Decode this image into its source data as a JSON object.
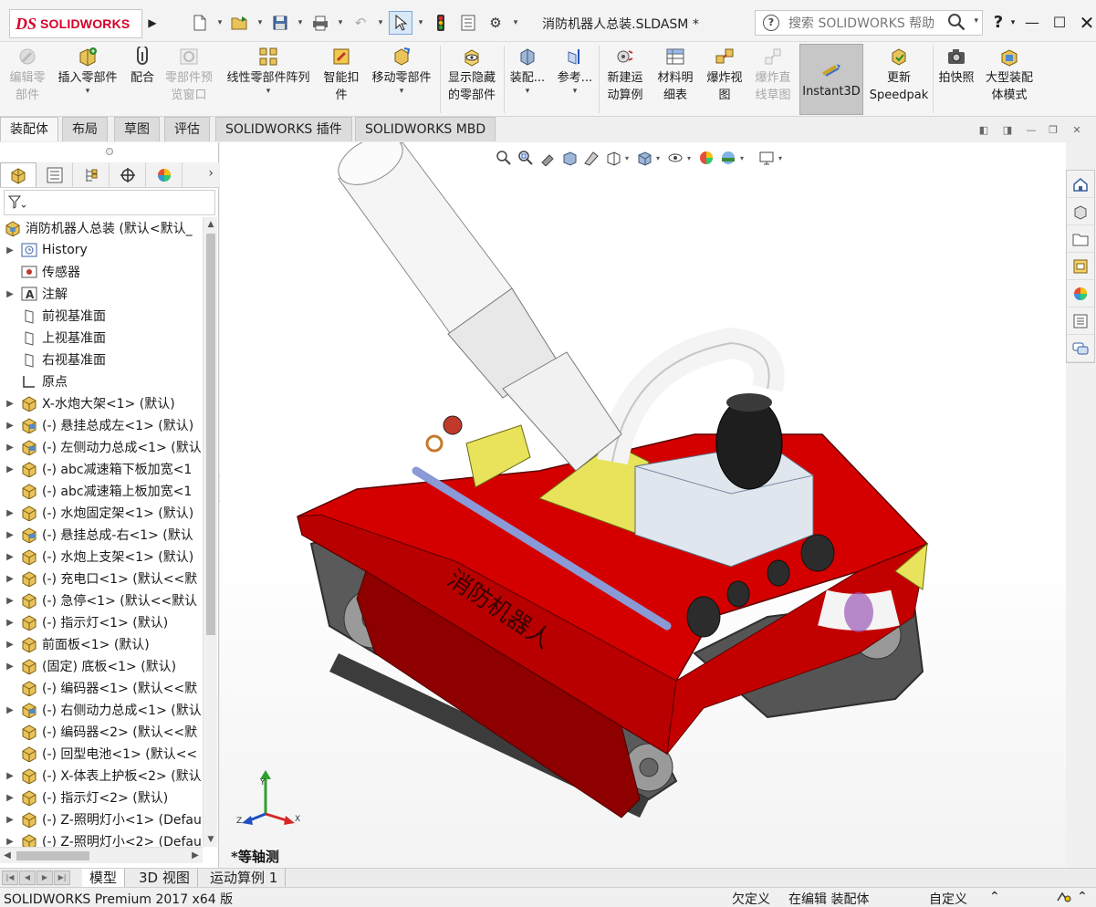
{
  "app": {
    "logo_ds": "DS",
    "logo_name": "SOLIDWORKS",
    "document_title": "消防机器人总装.SLDASM *",
    "search_placeholder": "搜索 SOLIDWORKS 帮助",
    "help_label": "?"
  },
  "ribbon": {
    "buttons": [
      {
        "label": "编辑零\n部件",
        "icon": "edit-component-icon",
        "disabled": true
      },
      {
        "label": "插入零部件",
        "icon": "insert-component-icon",
        "disabled": false
      },
      {
        "label": "配合",
        "icon": "mate-icon",
        "disabled": false
      },
      {
        "label": "零部件预\n览窗口",
        "icon": "preview-window-icon",
        "disabled": true
      },
      {
        "label": "线性零部件阵列",
        "icon": "linear-pattern-icon",
        "disabled": false
      },
      {
        "label": "智能扣\n件",
        "icon": "smart-fastener-icon",
        "disabled": false
      },
      {
        "label": "移动零部件",
        "icon": "move-component-icon",
        "disabled": false
      },
      {
        "label": "显示隐藏\n的零部件",
        "icon": "show-hidden-icon",
        "disabled": false
      },
      {
        "label": "装配...",
        "icon": "assembly-features-icon",
        "disabled": false
      },
      {
        "label": "参考...",
        "icon": "reference-geometry-icon",
        "disabled": false
      },
      {
        "label": "新建运\n动算例",
        "icon": "motion-study-icon",
        "disabled": false
      },
      {
        "label": "材料明\n细表",
        "icon": "bom-icon",
        "disabled": false
      },
      {
        "label": "爆炸视\n图",
        "icon": "exploded-view-icon",
        "disabled": false
      },
      {
        "label": "爆炸直\n线草图",
        "icon": "explode-line-icon",
        "disabled": true
      },
      {
        "label": "Instant3D",
        "icon": "instant3d-icon",
        "disabled": false
      },
      {
        "label": "更新\nSpeedpak",
        "icon": "speedpak-icon",
        "disabled": false
      },
      {
        "label": "拍快照",
        "icon": "snapshot-icon",
        "disabled": false
      },
      {
        "label": "大型装配\n体模式",
        "icon": "large-assembly-icon",
        "disabled": false
      }
    ]
  },
  "tabs": [
    "装配体",
    "布局",
    "草图",
    "评估",
    "SOLIDWORKS 插件",
    "SOLIDWORKS MBD"
  ],
  "tree": {
    "root": "消防机器人总装 (默认<默认_",
    "items": [
      {
        "label": "History",
        "icon": "history-icon",
        "expand": true
      },
      {
        "label": "传感器",
        "icon": "sensor-icon",
        "expand": false
      },
      {
        "label": "注解",
        "icon": "annotation-icon",
        "expand": true
      },
      {
        "label": "前视基准面",
        "icon": "plane-icon",
        "expand": false
      },
      {
        "label": "上视基准面",
        "icon": "plane-icon",
        "expand": false
      },
      {
        "label": "右视基准面",
        "icon": "plane-icon",
        "expand": false
      },
      {
        "label": "原点",
        "icon": "origin-icon",
        "expand": false
      },
      {
        "label": "X-水炮大架<1> (默认)",
        "icon": "part-icon",
        "expand": true
      },
      {
        "label": "(-) 悬挂总成左<1> (默认)",
        "icon": "subassembly-icon",
        "expand": true
      },
      {
        "label": "(-) 左侧动力总成<1> (默认",
        "icon": "subassembly-icon",
        "expand": true
      },
      {
        "label": "(-) abc减速箱下板加宽<1",
        "icon": "part-icon",
        "expand": true
      },
      {
        "label": "(-) abc减速箱上板加宽<1",
        "icon": "part-icon",
        "expand": false
      },
      {
        "label": "(-) 水炮固定架<1> (默认)",
        "icon": "part-icon",
        "expand": true
      },
      {
        "label": "(-) 悬挂总成-右<1> (默认",
        "icon": "subassembly-icon",
        "expand": true
      },
      {
        "label": "(-) 水炮上支架<1> (默认)",
        "icon": "part-icon",
        "expand": true
      },
      {
        "label": "(-) 充电口<1> (默认<<默",
        "icon": "part-icon",
        "expand": true
      },
      {
        "label": "(-) 急停<1> (默认<<默认",
        "icon": "part-icon",
        "expand": true
      },
      {
        "label": "(-) 指示灯<1> (默认)",
        "icon": "part-icon",
        "expand": true
      },
      {
        "label": "前面板<1> (默认)",
        "icon": "part-icon",
        "expand": true
      },
      {
        "label": "(固定) 底板<1> (默认)",
        "icon": "part-icon",
        "expand": true
      },
      {
        "label": "(-) 编码器<1> (默认<<默",
        "icon": "part-icon",
        "expand": false
      },
      {
        "label": "(-) 右侧动力总成<1> (默认",
        "icon": "subassembly-icon",
        "expand": true
      },
      {
        "label": "(-) 编码器<2> (默认<<默",
        "icon": "part-icon",
        "expand": false
      },
      {
        "label": "(-) 回型电池<1> (默认<<",
        "icon": "part-icon",
        "expand": false
      },
      {
        "label": "(-) X-体表上护板<2> (默认",
        "icon": "part-icon",
        "expand": true
      },
      {
        "label": "(-) 指示灯<2> (默认)",
        "icon": "part-icon",
        "expand": true
      },
      {
        "label": "(-) Z-照明灯小<1> (Defau",
        "icon": "part-icon",
        "expand": true
      },
      {
        "label": "(-) Z-照明灯小<2> (Defau",
        "icon": "part-icon",
        "expand": true
      }
    ]
  },
  "viewport": {
    "view_name": "*等轴测",
    "model_text": "消防机器人",
    "axis_x": "X",
    "axis_y": "Y",
    "axis_z": "Z"
  },
  "bottom_tabs": [
    "模型",
    "3D 视图",
    "运动算例 1"
  ],
  "status": {
    "product": "SOLIDWORKS Premium 2017 x64 版",
    "under_defined": "欠定义",
    "editing": "在编辑 装配体",
    "custom": "自定义"
  },
  "colors": {
    "brand_red": "#d6002a",
    "body_red": "#d40000",
    "body_dark_red": "#8e0000",
    "accent_yellow": "#e8e35a"
  }
}
